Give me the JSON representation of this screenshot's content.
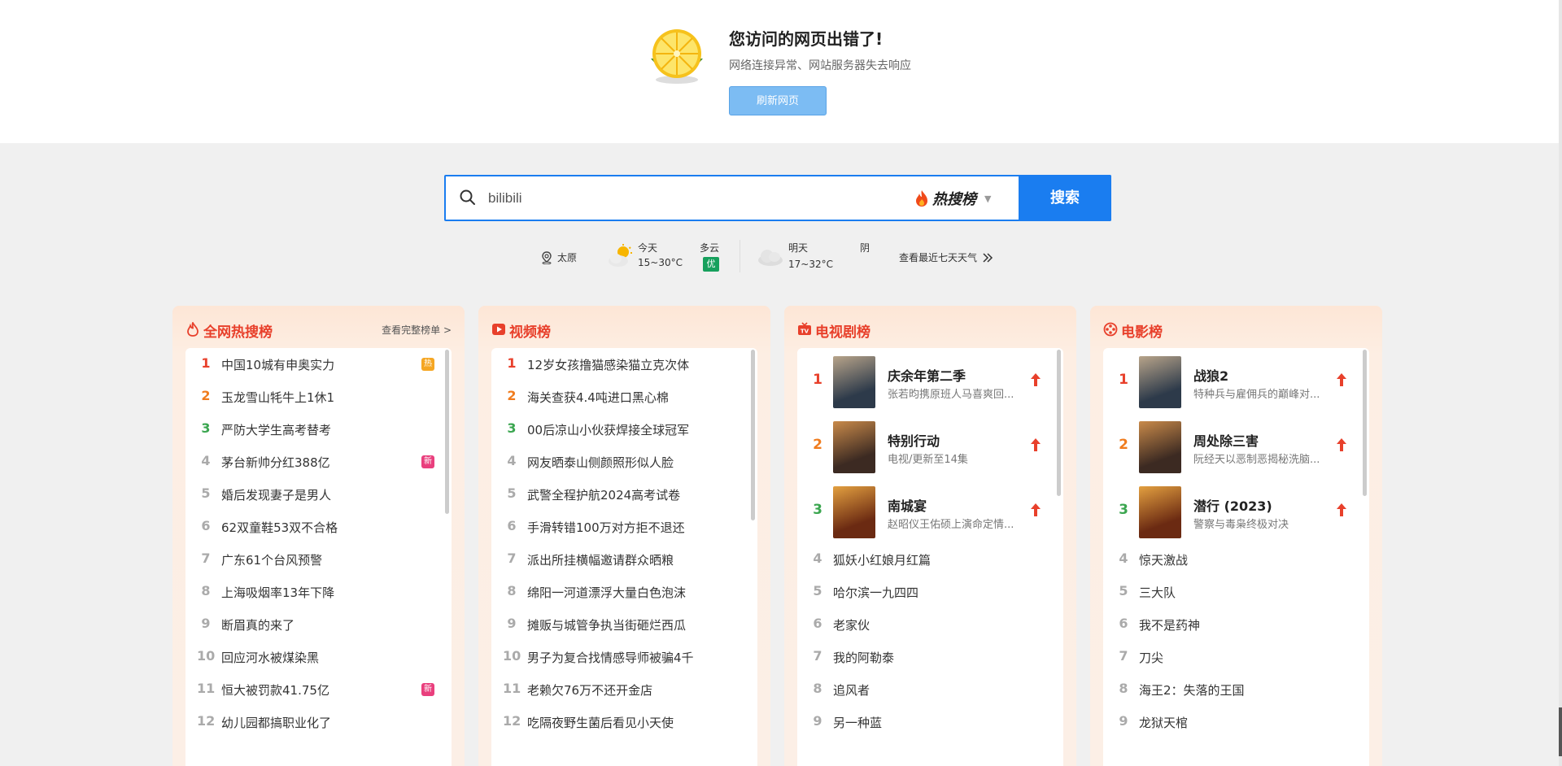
{
  "error": {
    "title": "您访问的网页出错了!",
    "subtitle": "网络连接异常、网站服务器失去响应",
    "refresh_label": "刷新网页"
  },
  "search": {
    "value": "bilibili",
    "brand": "热搜榜",
    "button_label": "搜索"
  },
  "weather": {
    "city": "太原",
    "today_label": "今天",
    "today_temp": "15~30°C",
    "today_cond": "多云",
    "aqi": "优",
    "tomorrow_label": "明天",
    "tomorrow_temp": "17~32°C",
    "tomorrow_cond": "阴",
    "week_link": "查看最近七天天气"
  },
  "colors": {
    "accent": "#1a7df0",
    "title_red": "#e8402b",
    "rank1": "#e8402b",
    "rank2": "#f07c1e",
    "rank3": "#3ba650"
  },
  "panels": {
    "hot": {
      "title": "全网热搜榜",
      "more": "查看完整榜单 >",
      "items": [
        {
          "rank": "1",
          "text": "中国10城有申奥实力",
          "tag": "热"
        },
        {
          "rank": "2",
          "text": "玉龙雪山牦牛上1休1"
        },
        {
          "rank": "3",
          "text": "严防大学生高考替考"
        },
        {
          "rank": "4",
          "text": "茅台新帅分红388亿",
          "tag": "新"
        },
        {
          "rank": "5",
          "text": "婚后发现妻子是男人",
          "tag": "😮"
        },
        {
          "rank": "6",
          "text": "62双童鞋53双不合格"
        },
        {
          "rank": "7",
          "text": "广东61个台风预警"
        },
        {
          "rank": "8",
          "text": "上海吸烟率13年下降"
        },
        {
          "rank": "9",
          "text": "断眉真的来了"
        },
        {
          "rank": "10",
          "text": "回应河水被煤染黑"
        },
        {
          "rank": "11",
          "text": "恒大被罚款41.75亿",
          "tag": "新"
        },
        {
          "rank": "12",
          "text": "幼儿园都搞职业化了"
        }
      ]
    },
    "video": {
      "title": "视频榜",
      "items": [
        {
          "rank": "1",
          "text": "12岁女孩撸猫感染猫立克次体"
        },
        {
          "rank": "2",
          "text": "海关查获4.4吨进口黑心棉"
        },
        {
          "rank": "3",
          "text": "00后凉山小伙获焊接全球冠军"
        },
        {
          "rank": "4",
          "text": "网友晒泰山侧颜照形似人脸"
        },
        {
          "rank": "5",
          "text": "武警全程护航2024高考试卷"
        },
        {
          "rank": "6",
          "text": "手滑转错100万对方拒不退还"
        },
        {
          "rank": "7",
          "text": "派出所挂横幅邀请群众晒粮"
        },
        {
          "rank": "8",
          "text": "绵阳一河道漂浮大量白色泡沫"
        },
        {
          "rank": "9",
          "text": "摊贩与城管争执当街砸烂西瓜"
        },
        {
          "rank": "10",
          "text": "男子为复合找情感导师被骗4千"
        },
        {
          "rank": "11",
          "text": "老赖欠76万不还开金店"
        },
        {
          "rank": "12",
          "text": "吃隔夜野生菌后看见小天使"
        }
      ]
    },
    "tv": {
      "title": "电视剧榜",
      "top": [
        {
          "rank": "1",
          "title": "庆余年第二季",
          "desc": "张若昀携原班人马喜爽回..."
        },
        {
          "rank": "2",
          "title": "特别行动",
          "desc": "电视/更新至14集"
        },
        {
          "rank": "3",
          "title": "南城宴",
          "desc": "赵昭仪王佑硕上演命定情..."
        }
      ],
      "items": [
        {
          "rank": "4",
          "text": "狐妖小红娘月红篇"
        },
        {
          "rank": "5",
          "text": "哈尔滨一九四四"
        },
        {
          "rank": "6",
          "text": "老家伙"
        },
        {
          "rank": "7",
          "text": "我的阿勒泰"
        },
        {
          "rank": "8",
          "text": "追风者"
        },
        {
          "rank": "9",
          "text": "另一种蓝"
        }
      ]
    },
    "movie": {
      "title": "电影榜",
      "top": [
        {
          "rank": "1",
          "title": "战狼2",
          "desc": "特种兵与雇佣兵的巅峰对..."
        },
        {
          "rank": "2",
          "title": "周处除三害",
          "desc": "阮经天以恶制恶揭秘洗脑..."
        },
        {
          "rank": "3",
          "title": "潜行 (2023)",
          "desc": "警察与毒枭终极对决"
        }
      ],
      "items": [
        {
          "rank": "4",
          "text": "惊天激战"
        },
        {
          "rank": "5",
          "text": "三大队"
        },
        {
          "rank": "6",
          "text": "我不是药神"
        },
        {
          "rank": "7",
          "text": "刀尖"
        },
        {
          "rank": "8",
          "text": "海王2：失落的王国"
        },
        {
          "rank": "9",
          "text": "龙狱天棺"
        }
      ]
    }
  }
}
